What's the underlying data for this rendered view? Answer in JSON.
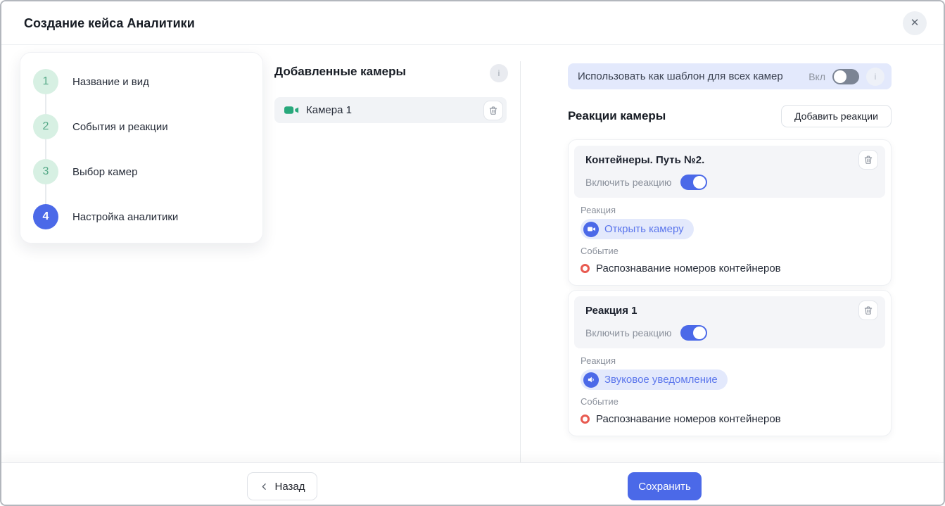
{
  "window": {
    "title": "Создание кейса Аналитики"
  },
  "wizard": {
    "steps": [
      {
        "number": "1",
        "label": "Название и вид"
      },
      {
        "number": "2",
        "label": "События и реакции"
      },
      {
        "number": "3",
        "label": "Выбор камер"
      },
      {
        "number": "4",
        "label": "Настройка аналитики"
      }
    ]
  },
  "cameras": {
    "title": "Добавленные камеры",
    "info_icon": "i",
    "items": [
      {
        "name": "Камера 1"
      }
    ]
  },
  "template_banner": {
    "label": "Использовать как шаблон для всех камер",
    "toggle_label": "Вкл",
    "toggle_state": "off",
    "info_icon": "i"
  },
  "reactions": {
    "title": "Реакции камеры",
    "add_button_label": "Добавить реакции",
    "cards": [
      {
        "title": "Контейнеры. Путь №2.",
        "enable_label": "Включить реакцию",
        "enabled": true,
        "reaction_label": "Реакция",
        "reaction_name": "Открыть камеру",
        "reaction_icon": "camera",
        "event_label": "Событие",
        "event_name": "Распознавание номеров контейнеров"
      },
      {
        "title": "Реакция 1",
        "enable_label": "Включить реакцию",
        "enabled": true,
        "reaction_label": "Реакция",
        "reaction_name": "Звуковое уведомление",
        "reaction_icon": "sound",
        "event_label": "Событие",
        "event_name": "Распознавание номеров контейнеров"
      }
    ]
  },
  "footer": {
    "back_label": "Назад",
    "save_label": "Сохранить"
  },
  "colors": {
    "accent_blue": "#4b69e8",
    "chip_bg": "#e3e9fc",
    "banner_bg": "#e3e9fc",
    "step_done_bg": "#d7f0e3",
    "step_done_text": "#55a988",
    "camera_green": "#28a87b",
    "event_red": "#e85a50"
  }
}
